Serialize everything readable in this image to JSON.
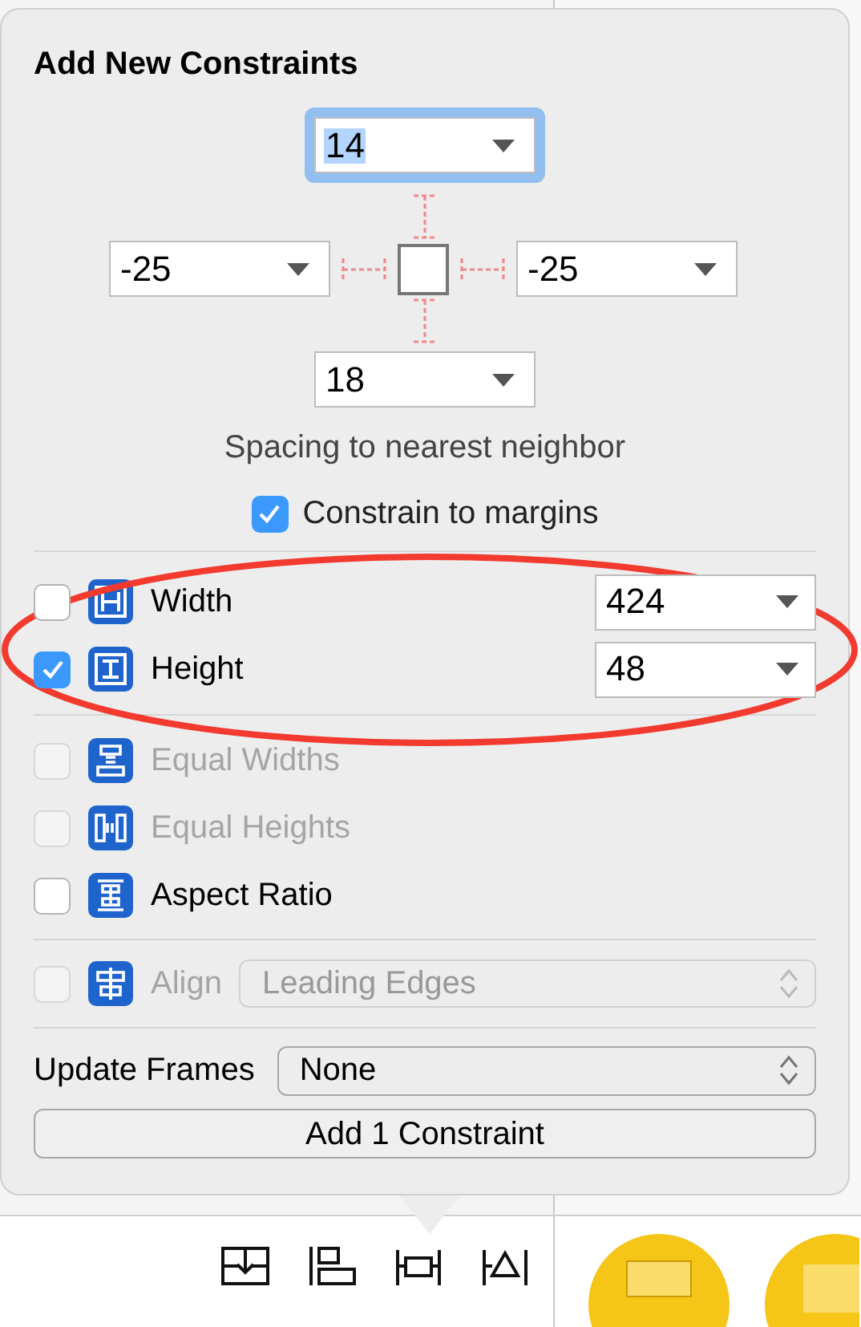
{
  "popover": {
    "title": "Add New Constraints",
    "spacing": [
      {
        "value": "14",
        "focused": true
      },
      {
        "value": "-25",
        "focused": false
      },
      {
        "value": "-25",
        "focused": false
      },
      {
        "value": "18",
        "focused": false
      }
    ],
    "spacing_caption": "Spacing to nearest neighbor",
    "constrain_to_margins": {
      "label": "Constrain to margins",
      "checked": true
    },
    "constraints": [
      {
        "kind": "width",
        "label": "Width",
        "checked": false,
        "disabled": false,
        "value": "424"
      },
      {
        "kind": "height",
        "label": "Height",
        "checked": true,
        "disabled": false,
        "value": "48"
      },
      {
        "kind": "equal-widths",
        "label": "Equal Widths",
        "checked": false,
        "disabled": true
      },
      {
        "kind": "equal-heights",
        "label": "Equal Heights",
        "checked": false,
        "disabled": true
      },
      {
        "kind": "aspect",
        "label": "Aspect Ratio",
        "checked": false,
        "disabled": false
      }
    ],
    "align": {
      "label": "Align",
      "checked": false,
      "disabled": true,
      "value": "Leading Edges"
    },
    "update_frames": {
      "label": "Update Frames",
      "value": "None"
    },
    "add_button": "Add 1 Constraint"
  }
}
